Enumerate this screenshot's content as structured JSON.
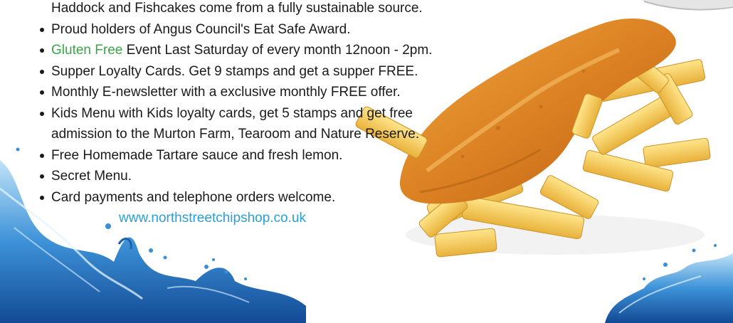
{
  "intro_line": "Haddock and Fishcakes come from a fully sustainable source.",
  "features": [
    {
      "text": "Proud holders of Angus Council's Eat Safe Award."
    },
    {
      "highlight": "Gluten Free",
      "text": " Event Last Saturday of every month 12noon - 2pm."
    },
    {
      "text": "Supper Loyalty Cards. Get 9 stamps and get a supper FREE."
    },
    {
      "text": "Monthly E-newsletter with a exclusive monthly FREE offer."
    },
    {
      "text": "Kids Menu with Kids loyalty cards, get 5 stamps and get free",
      "continuation": "admission to the Murton Farm, Tearoom and Nature Reserve."
    },
    {
      "text": "Free Homemade Tartare sauce and fresh lemon."
    },
    {
      "text": "Secret Menu."
    },
    {
      "text": "Card payments and telephone orders welcome."
    }
  ],
  "website": "www.northstreetchipshop.co.uk",
  "colors": {
    "highlight": "#3aa647",
    "link": "#2a9fd6",
    "text": "#1a1a1a",
    "water": "#2f86cf"
  },
  "images": [
    "fish-and-chips",
    "water-splash-left",
    "water-splash-right"
  ]
}
